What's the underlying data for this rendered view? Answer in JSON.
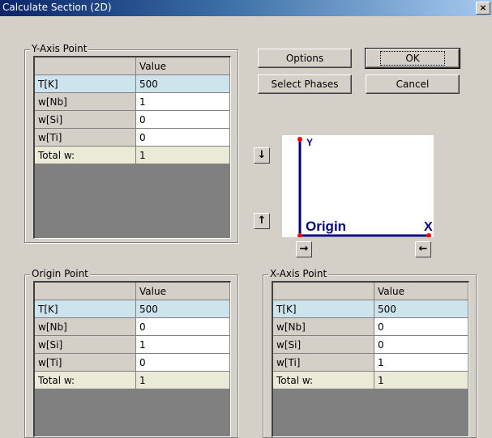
{
  "window": {
    "title": "Calculate Section (2D)",
    "close_glyph": "×"
  },
  "buttons": {
    "options": "Options",
    "ok": "OK",
    "select_phases": "Select Phases",
    "cancel": "Cancel"
  },
  "arrows": {
    "down": "↓",
    "up": "↑",
    "right": "→",
    "left": "←"
  },
  "preview": {
    "y_label": "Y",
    "origin_label": "Origin",
    "x_label": "X",
    "axis_color": "#000080",
    "point_color": "#ff0000"
  },
  "y_axis": {
    "title": "Y-Axis Point",
    "header": "Value",
    "rows": [
      {
        "label": "T[K]",
        "value": "500"
      },
      {
        "label": "w[Nb]",
        "value": "1"
      },
      {
        "label": "w[Si]",
        "value": "0"
      },
      {
        "label": "w[Ti]",
        "value": "0"
      },
      {
        "label": "Total w:",
        "value": "1"
      }
    ]
  },
  "origin": {
    "title": "Origin Point",
    "header": "Value",
    "rows": [
      {
        "label": "T[K]",
        "value": "500"
      },
      {
        "label": "w[Nb]",
        "value": "0"
      },
      {
        "label": "w[Si]",
        "value": "1"
      },
      {
        "label": "w[Ti]",
        "value": "0"
      },
      {
        "label": "Total w:",
        "value": "1"
      }
    ]
  },
  "x_axis": {
    "title": "X-Axis Point",
    "header": "Value",
    "rows": [
      {
        "label": "T[K]",
        "value": "500"
      },
      {
        "label": "w[Nb]",
        "value": "0"
      },
      {
        "label": "w[Si]",
        "value": "0"
      },
      {
        "label": "w[Ti]",
        "value": "1"
      },
      {
        "label": "Total w:",
        "value": "1"
      }
    ]
  }
}
